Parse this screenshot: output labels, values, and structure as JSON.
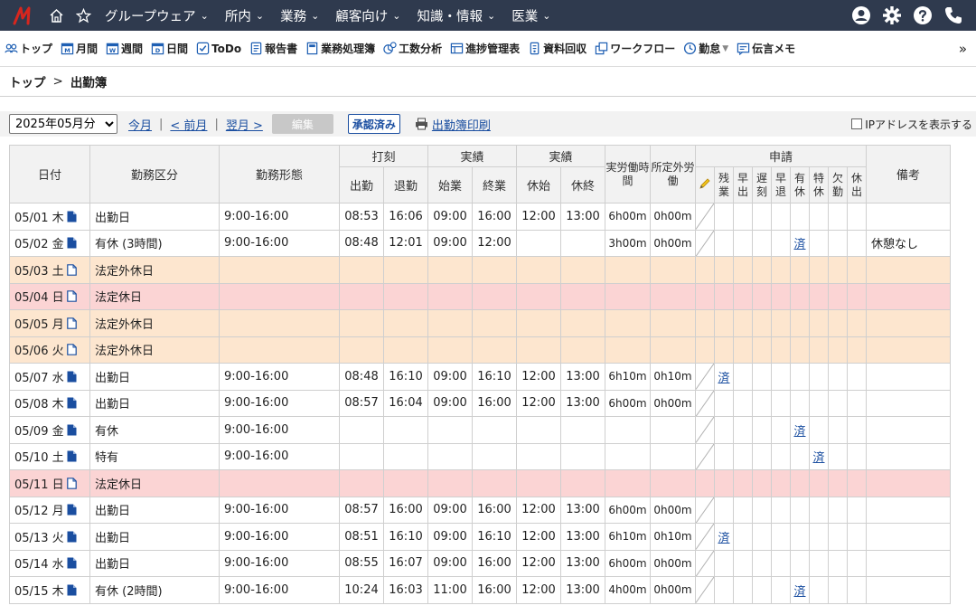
{
  "nav": {
    "menus": [
      "グループウェア",
      "所内",
      "業務",
      "顧客向け",
      "知識・情報",
      "医業"
    ]
  },
  "toolbar": {
    "items": [
      {
        "label": "トップ",
        "icon": "people-icon"
      },
      {
        "label": "月間",
        "icon": "calendar-month-icon"
      },
      {
        "label": "週間",
        "icon": "calendar-week-icon"
      },
      {
        "label": "日間",
        "icon": "calendar-day-icon"
      },
      {
        "label": "ToDo",
        "icon": "checkbox-icon"
      },
      {
        "label": "報告書",
        "icon": "report-icon"
      },
      {
        "label": "業務処理簿",
        "icon": "notebook-icon"
      },
      {
        "label": "工数分析",
        "icon": "analysis-icon"
      },
      {
        "label": "進捗管理表",
        "icon": "progress-table-icon"
      },
      {
        "label": "資料回収",
        "icon": "document-collect-icon"
      },
      {
        "label": "ワークフロー",
        "icon": "workflow-icon"
      },
      {
        "label": "勤怠",
        "icon": "clock-icon"
      },
      {
        "label": "伝言メモ",
        "icon": "memo-icon"
      }
    ],
    "more": "»"
  },
  "breadcrumb": {
    "home": "トップ",
    "sep": ">",
    "current": "出勤簿"
  },
  "controls": {
    "month": "2025年05月分",
    "this_month": "今月",
    "prev_month": "< 前月",
    "next_month": "翌月 >",
    "edit": "編集",
    "approved": "承認済み",
    "print": "出勤簿印刷",
    "ip_label": "IPアドレスを表示する"
  },
  "table": {
    "headers": {
      "date": "日付",
      "work_class": "勤務区分",
      "work_form": "勤務形態",
      "stamp": "打刻",
      "actual1": "実績",
      "actual2": "実績",
      "actual_hours": "実労働時間",
      "overtime": "所定外労働",
      "request": "申請",
      "remarks": "備考",
      "clock_in": "出勤",
      "clock_out": "退勤",
      "start": "始業",
      "end": "終業",
      "break_start": "休始",
      "break_end": "休終",
      "req_cols": [
        "残業",
        "早出",
        "遅刻",
        "早退",
        "有休",
        "特休",
        "欠勤",
        "休出"
      ]
    },
    "rows": [
      {
        "date": "05/01 木",
        "kind": "workday",
        "class": "出勤日",
        "form": "9:00-16:00",
        "in": "08:53",
        "out": "16:06",
        "start": "09:00",
        "end": "16:00",
        "bs": "12:00",
        "be": "13:00",
        "hours": "6h00m",
        "ot": "0h00m",
        "req": [
          "",
          "",
          "",
          "",
          "",
          "",
          "",
          ""
        ],
        "note": ""
      },
      {
        "date": "05/02 金",
        "kind": "workday",
        "class": "有休 (3時間)",
        "form": "9:00-16:00",
        "in": "08:48",
        "out": "12:01",
        "start": "09:00",
        "end": "12:00",
        "bs": "",
        "be": "",
        "hours": "3h00m",
        "ot": "0h00m",
        "req": [
          "",
          "",
          "",
          "",
          "済",
          "",
          "",
          ""
        ],
        "note": "休憩なし"
      },
      {
        "date": "05/03 土",
        "kind": "nonlegal",
        "class": "法定外休日",
        "form": "",
        "in": "",
        "out": "",
        "start": "",
        "end": "",
        "bs": "",
        "be": "",
        "hours": "",
        "ot": "",
        "req": [
          "",
          "",
          "",
          "",
          "",
          "",
          "",
          ""
        ],
        "note": ""
      },
      {
        "date": "05/04 日",
        "kind": "legal",
        "class": "法定休日",
        "form": "",
        "in": "",
        "out": "",
        "start": "",
        "end": "",
        "bs": "",
        "be": "",
        "hours": "",
        "ot": "",
        "req": [
          "",
          "",
          "",
          "",
          "",
          "",
          "",
          ""
        ],
        "note": ""
      },
      {
        "date": "05/05 月",
        "kind": "nonlegal",
        "class": "法定外休日",
        "form": "",
        "in": "",
        "out": "",
        "start": "",
        "end": "",
        "bs": "",
        "be": "",
        "hours": "",
        "ot": "",
        "req": [
          "",
          "",
          "",
          "",
          "",
          "",
          "",
          ""
        ],
        "note": ""
      },
      {
        "date": "05/06 火",
        "kind": "nonlegal",
        "class": "法定外休日",
        "form": "",
        "in": "",
        "out": "",
        "start": "",
        "end": "",
        "bs": "",
        "be": "",
        "hours": "",
        "ot": "",
        "req": [
          "",
          "",
          "",
          "",
          "",
          "",
          "",
          ""
        ],
        "note": ""
      },
      {
        "date": "05/07 水",
        "kind": "workday",
        "class": "出勤日",
        "form": "9:00-16:00",
        "in": "08:48",
        "out": "16:10",
        "start": "09:00",
        "end": "16:10",
        "bs": "12:00",
        "be": "13:00",
        "hours": "6h10m",
        "ot": "0h10m",
        "req": [
          "済",
          "",
          "",
          "",
          "",
          "",
          "",
          ""
        ],
        "note": ""
      },
      {
        "date": "05/08 木",
        "kind": "workday",
        "class": "出勤日",
        "form": "9:00-16:00",
        "in": "08:57",
        "out": "16:04",
        "start": "09:00",
        "end": "16:00",
        "bs": "12:00",
        "be": "13:00",
        "hours": "6h00m",
        "ot": "0h00m",
        "req": [
          "",
          "",
          "",
          "",
          "",
          "",
          "",
          ""
        ],
        "note": ""
      },
      {
        "date": "05/09 金",
        "kind": "workday",
        "class": "有休",
        "form": "9:00-16:00",
        "in": "",
        "out": "",
        "start": "",
        "end": "",
        "bs": "",
        "be": "",
        "hours": "",
        "ot": "",
        "req": [
          "",
          "",
          "",
          "",
          "済",
          "",
          "",
          ""
        ],
        "note": ""
      },
      {
        "date": "05/10 土",
        "kind": "workday",
        "class": "特有",
        "form": "9:00-16:00",
        "in": "",
        "out": "",
        "start": "",
        "end": "",
        "bs": "",
        "be": "",
        "hours": "",
        "ot": "",
        "req": [
          "",
          "",
          "",
          "",
          "",
          "済",
          "",
          ""
        ],
        "note": ""
      },
      {
        "date": "05/11 日",
        "kind": "legal",
        "class": "法定休日",
        "form": "",
        "in": "",
        "out": "",
        "start": "",
        "end": "",
        "bs": "",
        "be": "",
        "hours": "",
        "ot": "",
        "req": [
          "",
          "",
          "",
          "",
          "",
          "",
          "",
          ""
        ],
        "note": ""
      },
      {
        "date": "05/12 月",
        "kind": "workday",
        "class": "出勤日",
        "form": "9:00-16:00",
        "in": "08:57",
        "out": "16:00",
        "start": "09:00",
        "end": "16:00",
        "bs": "12:00",
        "be": "13:00",
        "hours": "6h00m",
        "ot": "0h00m",
        "req": [
          "",
          "",
          "",
          "",
          "",
          "",
          "",
          ""
        ],
        "note": ""
      },
      {
        "date": "05/13 火",
        "kind": "workday",
        "class": "出勤日",
        "form": "9:00-16:00",
        "in": "08:51",
        "out": "16:10",
        "start": "09:00",
        "end": "16:10",
        "bs": "12:00",
        "be": "13:00",
        "hours": "6h10m",
        "ot": "0h10m",
        "req": [
          "済",
          "",
          "",
          "",
          "",
          "",
          "",
          ""
        ],
        "note": ""
      },
      {
        "date": "05/14 水",
        "kind": "workday",
        "class": "出勤日",
        "form": "9:00-16:00",
        "in": "08:55",
        "out": "16:07",
        "start": "09:00",
        "end": "16:00",
        "bs": "12:00",
        "be": "13:00",
        "hours": "6h00m",
        "ot": "0h00m",
        "req": [
          "",
          "",
          "",
          "",
          "",
          "",
          "",
          ""
        ],
        "note": ""
      },
      {
        "date": "05/15 木",
        "kind": "workday",
        "class": "有休 (2時間)",
        "form": "9:00-16:00",
        "in": "10:24",
        "out": "16:03",
        "start": "11:00",
        "end": "16:00",
        "bs": "12:00",
        "be": "13:00",
        "hours": "4h00m",
        "ot": "0h00m",
        "req": [
          "",
          "",
          "",
          "",
          "済",
          "",
          "",
          ""
        ],
        "note": ""
      }
    ]
  },
  "colors": {
    "nav_bg": "#2f3a4e",
    "link": "#1a4ea0",
    "legal_holiday_bg": "#fbd4d4",
    "nonlegal_holiday_bg": "#fde6cf",
    "header_bg": "#f2f2f2",
    "logo_red": "#d7261e"
  }
}
